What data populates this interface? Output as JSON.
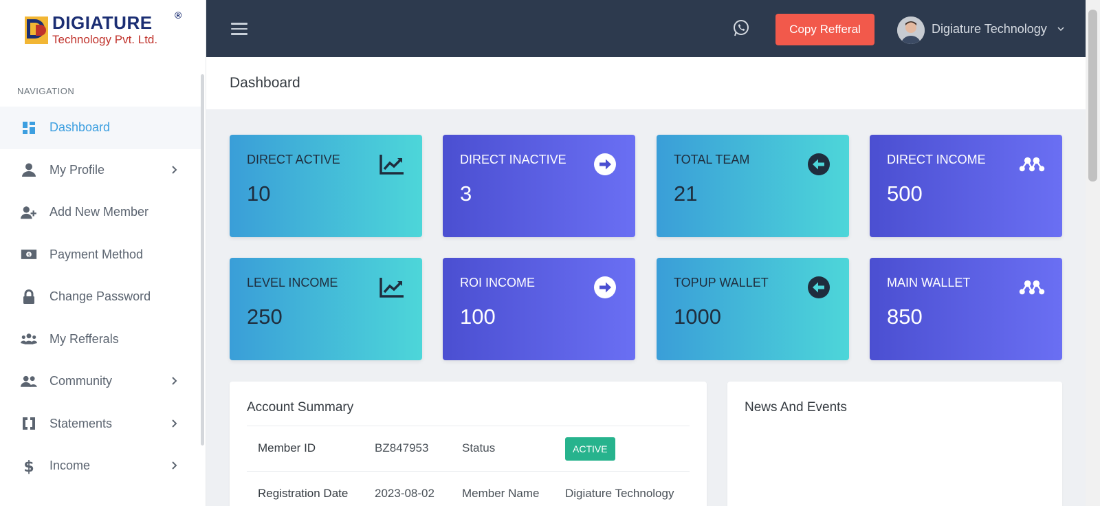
{
  "brand": {
    "title": "DIGIATURE",
    "reg_mark": "®",
    "subtitle": "Technology Pvt. Ltd."
  },
  "sidebar": {
    "heading": "NAVIGATION",
    "items": [
      {
        "label": "Dashboard",
        "icon": "dashboard-icon",
        "active": true,
        "has_submenu": false
      },
      {
        "label": "My Profile",
        "icon": "user-icon",
        "active": false,
        "has_submenu": true
      },
      {
        "label": "Add New Member",
        "icon": "user-plus-icon",
        "active": false,
        "has_submenu": false
      },
      {
        "label": "Payment Method",
        "icon": "money-bill-icon",
        "active": false,
        "has_submenu": false
      },
      {
        "label": "Change Password",
        "icon": "lock-icon",
        "active": false,
        "has_submenu": false
      },
      {
        "label": "My Refferals",
        "icon": "users-icon",
        "active": false,
        "has_submenu": false
      },
      {
        "label": "Community",
        "icon": "user-group-icon",
        "active": false,
        "has_submenu": true
      },
      {
        "label": "Statements",
        "icon": "statement-icon",
        "active": false,
        "has_submenu": true
      },
      {
        "label": "Income",
        "icon": "dollar-icon",
        "active": false,
        "has_submenu": true
      }
    ]
  },
  "topbar": {
    "copy_button": "Copy Refferal",
    "user_name": "Digiature Technology"
  },
  "page": {
    "title": "Dashboard"
  },
  "cards": [
    {
      "label": "DIRECT ACTIVE",
      "value": "10",
      "icon": "chart-line-icon"
    },
    {
      "label": "DIRECT INACTIVE",
      "value": "3",
      "icon": "arrow-circle-right-icon"
    },
    {
      "label": "TOTAL TEAM",
      "value": "21",
      "icon": "arrow-circle-left-icon"
    },
    {
      "label": "DIRECT INCOME",
      "value": "500",
      "icon": "network-icon"
    },
    {
      "label": "LEVEL INCOME",
      "value": "250",
      "icon": "chart-line-icon"
    },
    {
      "label": "ROI INCOME",
      "value": "100",
      "icon": "arrow-circle-right-icon"
    },
    {
      "label": "TOPUP WALLET",
      "value": "1000",
      "icon": "arrow-circle-left-icon"
    },
    {
      "label": "MAIN WALLET",
      "value": "850",
      "icon": "network-icon"
    }
  ],
  "account_summary": {
    "title": "Account Summary",
    "rows": [
      {
        "k1": "Member ID",
        "v1": "BZ847953",
        "k2": "Status",
        "v2": "ACTIVE"
      },
      {
        "k1": "Registration Date",
        "v1": "2023-08-02",
        "k2": "Member Name",
        "v2": "Digiature Technology"
      }
    ]
  },
  "news": {
    "title": "News And Events"
  },
  "colors": {
    "topbar": "#2d3a4e",
    "accent_button": "#f2594b",
    "active_nav": "#3d9fe0",
    "card_teal_start": "#3a9ed8",
    "card_teal_end": "#4dd6d9",
    "card_indigo_start": "#4b4fd1",
    "card_indigo_end": "#6a6ff3",
    "status_badge": "#27b38d"
  }
}
